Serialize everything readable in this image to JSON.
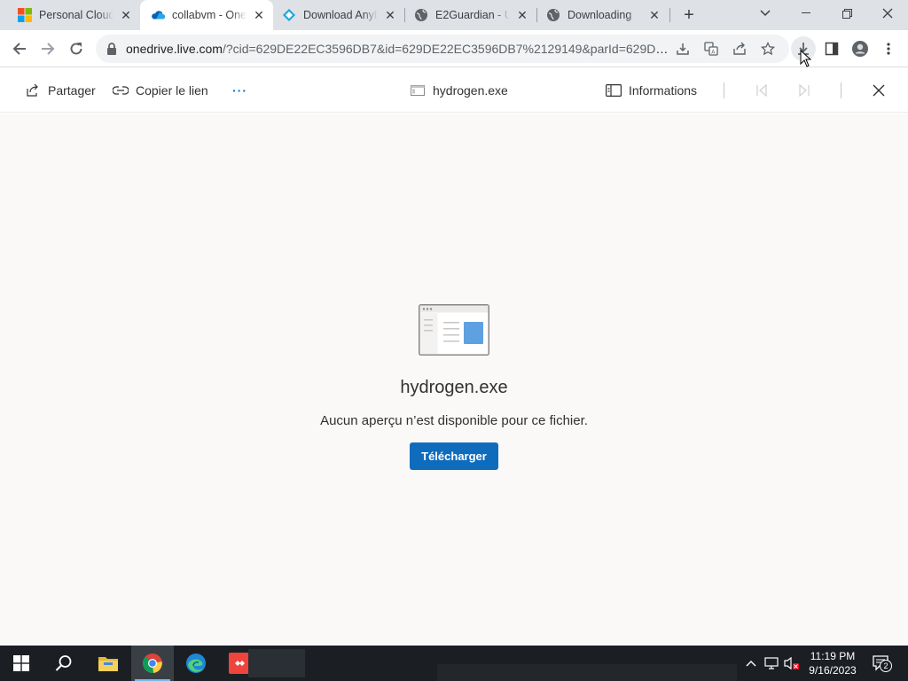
{
  "browser": {
    "tabs": [
      {
        "title": "Personal Cloud S",
        "favicon": "microsoft-logo-icon",
        "active": false
      },
      {
        "title": "collabvm - OneD",
        "favicon": "onedrive-cloud-icon",
        "active": true
      },
      {
        "title": "Download AnyDe",
        "favicon": "anydesk-icon",
        "active": false
      },
      {
        "title": "E2Guardian - Un",
        "favicon": "globe-icon",
        "active": false
      },
      {
        "title": "Downloading",
        "favicon": "globe-icon",
        "active": false
      }
    ],
    "url_host": "onedrive.live.com",
    "url_path": "/?cid=629DE22EC3596DB7&id=629DE22EC3596DB7%2129149&parId=629DE2..."
  },
  "commandbar": {
    "share_label": "Partager",
    "copy_link_label": "Copier le lien",
    "more_label": "···",
    "file_name": "hydrogen.exe",
    "info_label": "Informations"
  },
  "viewer": {
    "file_name": "hydrogen.exe",
    "message": "Aucun aperçu n’est disponible pour ce fichier.",
    "download_label": "Télécharger"
  },
  "taskbar": {
    "time": "11:19 PM",
    "date": "9/16/2023",
    "notification_count": "2"
  },
  "colors": {
    "accent": "#0f6cbd",
    "tabstrip": "#dee1e6",
    "taskbar": "#1b1f24"
  }
}
